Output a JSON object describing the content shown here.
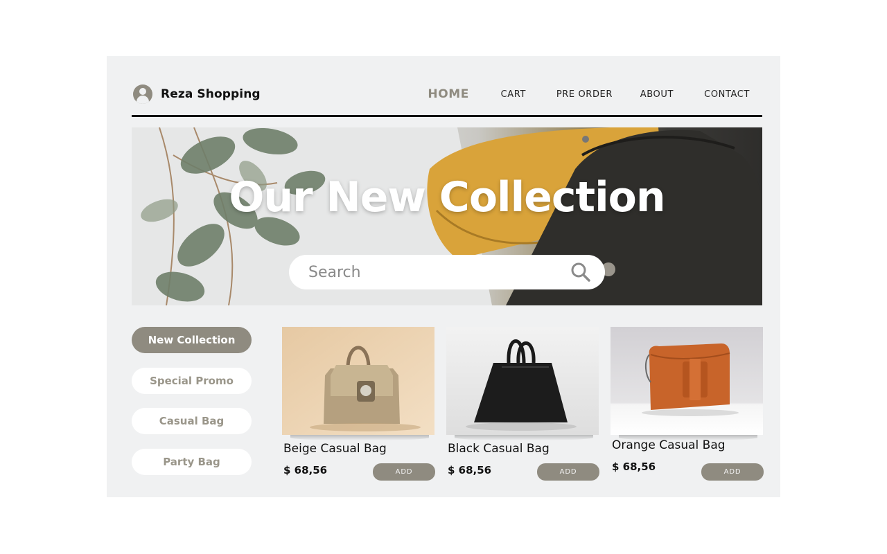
{
  "brand": {
    "name": "Reza Shopping",
    "icon": "user-avatar-icon"
  },
  "nav": {
    "items": [
      "HOME",
      "CART",
      "PRE ORDER",
      "ABOUT",
      "CONTACT"
    ],
    "active": "HOME"
  },
  "hero": {
    "title": "Our New Collection"
  },
  "search": {
    "placeholder": "Search",
    "icon": "search-icon"
  },
  "categories": [
    "New Collection",
    "Special Promo",
    "Casual Bag",
    "Party Bag"
  ],
  "active_category": "New Collection",
  "products": [
    {
      "name": "Beige Casual Bag",
      "price": "$ 68,56",
      "button": "ADD"
    },
    {
      "name": "Black Casual Bag",
      "price": "$ 68,56",
      "button": "ADD"
    },
    {
      "name": "Orange Casual Bag",
      "price": "$ 68,56",
      "button": "ADD"
    }
  ],
  "colors": {
    "accent": "#8f8b80",
    "panel": "#f0f1f2",
    "text": "#111111"
  }
}
